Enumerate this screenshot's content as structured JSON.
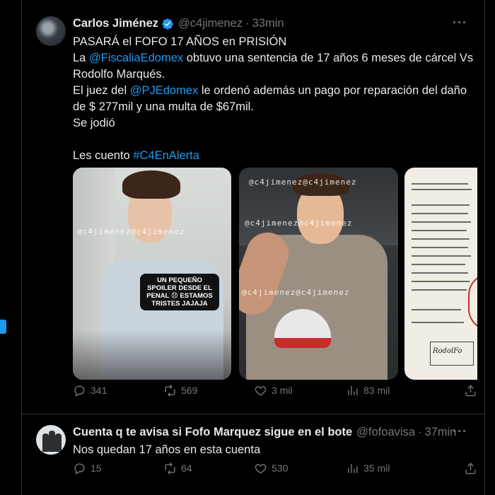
{
  "tweet1": {
    "author_name": "Carlos Jiménez",
    "handle": "@c4jimenez",
    "separator": "·",
    "time": "33min",
    "more": "···",
    "lines": [
      {
        "pre": "PASARÁ el FOFO 17 AÑOS en PRISIÓN",
        "link": "",
        "post": ""
      },
      {
        "pre": "La ",
        "link": "@FiscaliaEdomex",
        "post": " obtuvo una sentencia de 17 años 6 meses de cárcel Vs"
      },
      {
        "pre": "Rodolfo Marqués.",
        "link": "",
        "post": ""
      },
      {
        "pre": "El juez del ",
        "link": "@PJEdomex",
        "post": " le ordenó además un pago por reparación del daño"
      },
      {
        "pre": "de $ 277mil y una multa de $67mil.",
        "link": "",
        "post": ""
      },
      {
        "pre": "Se jodió",
        "link": "",
        "post": ""
      },
      {
        "pre": "",
        "link": "",
        "post": ""
      },
      {
        "pre": "Les cuento ",
        "link": "#C4EnAlerta",
        "post": ""
      }
    ],
    "media": {
      "watermark": "@c4jimenez@c4jimenez",
      "sticker_text": "UN PEQUEÑO SPOILER DESDE EL PENAL 😞 ESTAMOS TRISTES JAJAJA",
      "doc_stamp": "RodolFo"
    },
    "actions": {
      "replies": "341",
      "reposts": "569",
      "likes": "3 mil",
      "views": "83 mil"
    }
  },
  "tweet2": {
    "author_name": "Cuenta q te avisa si Fofo Marquez sigue en el bote",
    "handle": "@fofoavisa",
    "separator": "·",
    "time": "37min",
    "more": "···",
    "text": "Nos quedan 17 años en esta cuenta",
    "actions": {
      "replies": "15",
      "reposts": "64",
      "likes": "530",
      "views": "35 mil"
    }
  },
  "colors": {
    "background": "#000000",
    "text": "#e7e9ea",
    "muted": "#71767b",
    "link": "#1d9bf0",
    "border": "#2f3336"
  },
  "icons": [
    "verified-badge-icon",
    "more-icon",
    "reply-icon",
    "repost-icon",
    "like-icon",
    "views-icon",
    "share-icon"
  ]
}
